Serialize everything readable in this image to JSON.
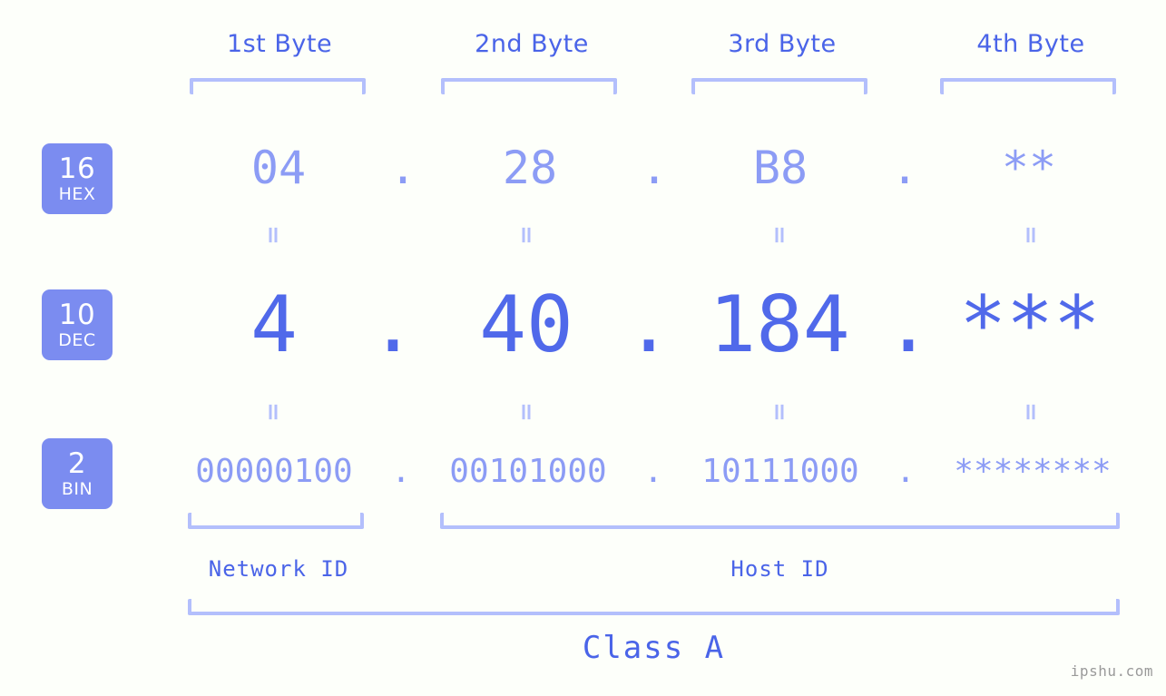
{
  "headers": [
    {
      "label": "1st Byte"
    },
    {
      "label": "2nd Byte"
    },
    {
      "label": "3rd Byte"
    },
    {
      "label": "4th Byte"
    }
  ],
  "bases": [
    {
      "num": "16",
      "abbr": "HEX"
    },
    {
      "num": "10",
      "abbr": "DEC"
    },
    {
      "num": "2",
      "abbr": "BIN"
    }
  ],
  "rows": {
    "hex": {
      "octets": [
        "04",
        "28",
        "B8",
        "**"
      ],
      "separator": "."
    },
    "dec": {
      "octets": [
        "4",
        "40",
        "184",
        "***"
      ],
      "separator": "."
    },
    "bin": {
      "octets": [
        "00000100",
        "00101000",
        "10111000",
        "********"
      ],
      "separator": "."
    }
  },
  "connector": "=",
  "sections": [
    {
      "label": "Network ID"
    },
    {
      "label": "Host ID"
    }
  ],
  "class": {
    "label": "Class A"
  },
  "watermark": {
    "text": "ipshu.com"
  },
  "colors": {
    "background": "#fdfffa",
    "accent_strong": "#4a64e8",
    "accent_dec": "#5069ea",
    "accent_light": "#8c9cf5",
    "bracket": "#b3bffc",
    "badge_bg": "#7b8cf0",
    "badge_text": "#ffffff",
    "watermark": "#9a9a9a"
  }
}
